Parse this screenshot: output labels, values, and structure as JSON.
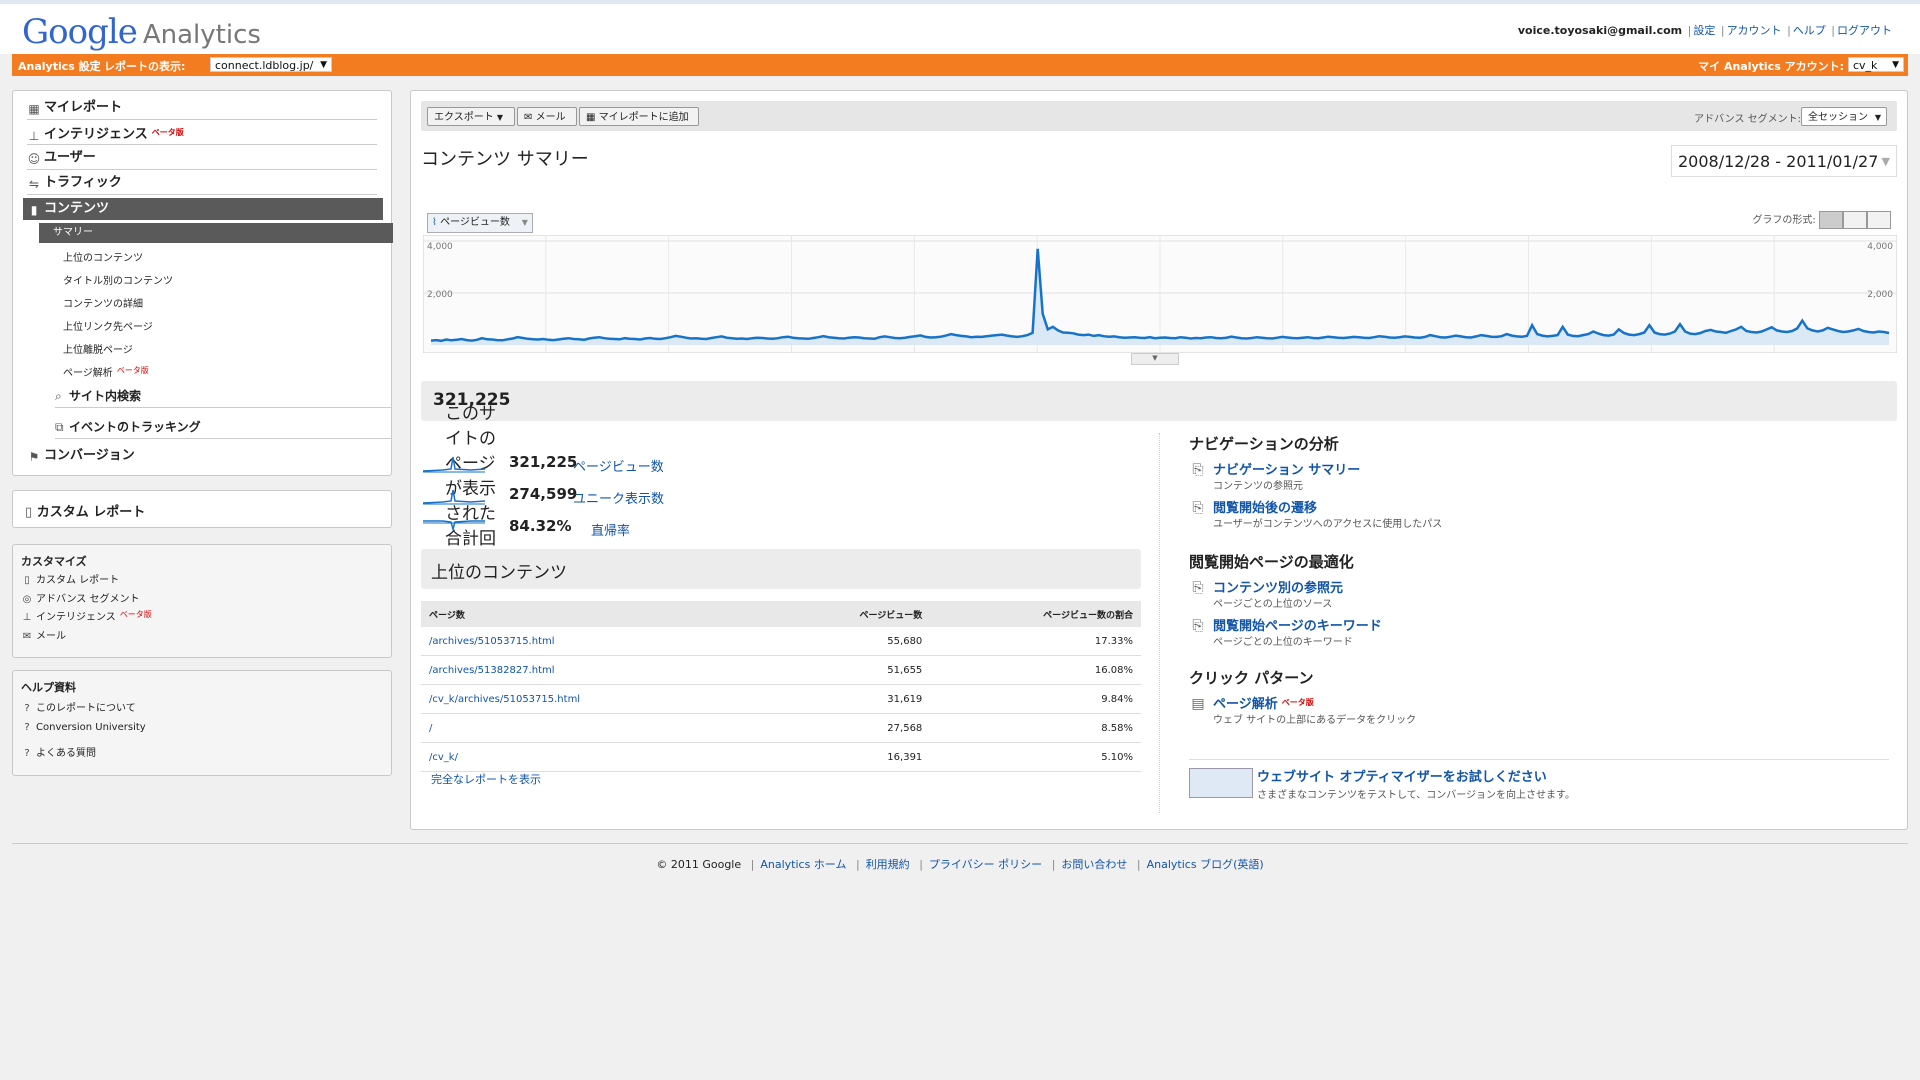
{
  "header": {
    "logo_google": "Google",
    "logo_analytics": "Analytics",
    "user_email": "voice.toyosaki@gmail.com",
    "links": [
      "設定",
      "アカウント",
      "ヘルプ",
      "ログアウト"
    ]
  },
  "orangebar": {
    "settings_label": "Analytics 設定",
    "report_label": "レポートの表示:",
    "profile_value": "connect.ldblog.jp/",
    "account_label": "マイ Analytics アカウント:",
    "account_value": "cv_k"
  },
  "nav": {
    "items": [
      {
        "label": "マイレポート",
        "icon": "grid-icon"
      },
      {
        "label": "インテリジェンス",
        "icon": "chart-icon",
        "badge": "ベータ版"
      },
      {
        "label": "ユーザー",
        "icon": "user-icon"
      },
      {
        "label": "トラフィック",
        "icon": "traffic-icon"
      },
      {
        "label": "コンテンツ",
        "icon": "page-icon"
      }
    ],
    "sub_active": "サマリー",
    "sub_items": [
      "上位のコンテンツ",
      "タイトル別のコンテンツ",
      "コンテンツの詳細",
      "上位リンク先ページ",
      "上位離脱ページ",
      "ページ解析"
    ],
    "sub_beta": "ベータ版",
    "site_search": "サイト内検索",
    "event_tracking": "イベントのトラッキング",
    "conversion": "コンバージョン"
  },
  "custom_report": "カスタム レポート",
  "customize": {
    "title": "カスタマイズ",
    "items": [
      "カスタム レポート",
      "アドバンス セグメント",
      "インテリジェンス",
      "メール"
    ],
    "beta": "ベータ版"
  },
  "help": {
    "title": "ヘルプ資料",
    "items": [
      "このレポートについて",
      "Conversion University",
      "よくある質問"
    ]
  },
  "toolbar": {
    "export": "エクスポート",
    "mail": "メール",
    "add_report": "マイレポートに追加",
    "segment_label": "アドバンス セグメント:",
    "segment_value": "全セッション"
  },
  "page_title": "コンテンツ サマリー",
  "date_range": "2008/12/28 - 2011/01/27",
  "graph": {
    "metric_button": "ページビュー数",
    "format_label": "グラフの形式:",
    "ytick_top": "4,000",
    "ytick_mid": "2,000"
  },
  "chart_data": {
    "type": "line",
    "series": [
      {
        "name": "ページビュー数",
        "values": [
          170,
          190,
          160,
          210,
          180,
          200,
          230,
          190,
          170,
          200,
          260,
          220,
          210,
          190,
          180,
          220,
          250,
          300,
          270,
          240,
          220,
          210,
          230,
          200,
          190,
          210,
          240,
          260,
          230,
          220,
          200,
          250,
          280,
          300,
          260,
          240,
          230,
          220,
          260,
          240,
          230,
          210,
          250,
          270,
          240,
          230,
          260,
          300,
          350,
          320,
          280,
          250,
          260,
          240,
          230,
          270,
          300,
          330,
          280,
          260,
          240,
          250,
          230,
          260,
          280,
          270,
          250,
          240,
          260,
          300,
          320,
          280,
          260,
          250,
          240,
          270,
          300,
          340,
          300,
          280,
          260,
          250,
          280,
          300,
          290,
          260,
          250,
          240,
          300,
          330,
          300,
          270,
          260,
          280,
          310,
          340,
          370,
          310,
          290,
          300,
          320,
          360,
          420,
          380,
          350,
          330,
          300,
          320,
          310,
          340,
          360,
          380,
          400,
          360,
          330,
          310,
          340,
          380,
          470,
          3700,
          1200,
          600,
          700,
          560,
          480,
          470,
          450,
          400,
          380,
          400,
          350,
          380,
          340,
          320,
          330,
          300,
          280,
          290,
          300,
          280,
          270,
          300,
          260,
          280,
          290,
          270,
          260,
          300,
          280,
          250,
          270,
          260,
          290,
          300,
          270,
          260,
          280,
          320,
          290,
          260,
          250,
          270,
          300,
          280,
          260,
          250,
          280,
          310,
          290,
          270,
          260,
          280,
          300,
          270,
          260,
          290,
          320,
          300,
          280,
          270,
          290,
          310,
          300,
          280,
          270,
          300,
          340,
          320,
          290,
          280,
          300,
          330,
          310,
          290,
          280,
          310,
          380,
          340,
          300,
          290,
          320,
          360,
          330,
          300,
          290,
          330,
          380,
          350,
          320,
          310,
          340,
          420,
          360,
          330,
          320,
          350,
          760,
          420,
          360,
          330,
          350,
          380,
          700,
          400,
          350,
          340,
          380,
          420,
          520,
          440,
          380,
          360,
          400,
          600,
          460,
          400,
          380,
          420,
          480,
          760,
          480,
          420,
          400,
          440,
          520,
          800,
          520,
          440,
          420,
          460,
          540,
          580,
          520,
          500,
          470,
          540,
          600,
          700,
          540,
          500,
          480,
          520,
          600,
          680,
          560,
          520,
          500,
          540,
          640,
          940,
          640,
          560,
          520,
          560,
          660,
          600,
          540,
          500,
          520,
          560,
          620,
          540,
          500,
          480,
          520,
          500,
          460
        ]
      }
    ],
    "ylim": [
      0,
      4000
    ],
    "yticks": [
      "4,000",
      "2,000"
    ],
    "grid": true
  },
  "total": {
    "label": "このサイトのページが表示された合計回数",
    "value": "321,225"
  },
  "kpis": [
    {
      "value": "321,225",
      "label": "ページビュー数"
    },
    {
      "value": "274,599",
      "label": "ユニーク表示数"
    },
    {
      "value": "84.32%",
      "label": "直帰率"
    }
  ],
  "top_content": {
    "title": "上位のコンテンツ",
    "headers": [
      "ページ数",
      "ページビュー数",
      "ページビュー数の割合"
    ],
    "rows": [
      [
        "/archives/51053715.html",
        "55,680",
        "17.33%"
      ],
      [
        "/archives/51382827.html",
        "51,655",
        "16.08%"
      ],
      [
        "/cv_k/archives/51053715.html",
        "31,619",
        "9.84%"
      ],
      [
        "/",
        "27,568",
        "8.58%"
      ],
      [
        "/cv_k/",
        "16,391",
        "5.10%"
      ]
    ],
    "full_report": "完全なレポートを表示"
  },
  "right": {
    "nav_title": "ナビゲーションの分析",
    "nav_summary": "ナビゲーション サマリー",
    "nav_summary_desc": "コンテンツの参照元",
    "nav_path": "閲覧開始後の遷移",
    "nav_path_desc": "ユーザーがコンテンツへのアクセスに使用したパス",
    "opt_title": "閲覧開始ページの最適化",
    "opt_source": "コンテンツ別の参照元",
    "opt_source_desc": "ページごとの上位のソース",
    "opt_keyword": "閲覧開始ページのキーワード",
    "opt_keyword_desc": "ページごとの上位のキーワード",
    "click_title": "クリック パターン",
    "click_overlay": "ページ解析",
    "click_beta": "ベータ版",
    "click_desc": "ウェブ サイトの上部にあるデータをクリック",
    "optimizer_title": "ウェブサイト オプティマイザーをお試しください",
    "optimizer_desc": "さまざまなコンテンツをテストして、コンバージョンを向上させます。"
  },
  "footer": {
    "copyright": "© 2011 Google",
    "links": [
      "Analytics ホーム",
      "利用規約",
      "プライバシー ポリシー",
      "お問い合わせ",
      "Analytics ブログ(英語)"
    ]
  }
}
